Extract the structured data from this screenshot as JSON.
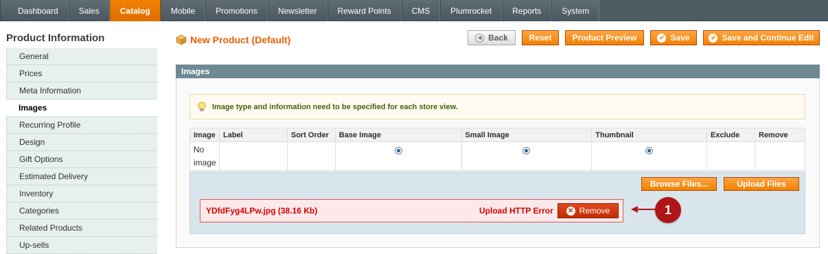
{
  "topnav": {
    "items": [
      "Dashboard",
      "Sales",
      "Catalog",
      "Mobile",
      "Promotions",
      "Newsletter",
      "Reward Points",
      "CMS",
      "Plumrocket",
      "Reports",
      "System"
    ],
    "active": "Catalog"
  },
  "sidebar": {
    "title": "Product Information",
    "items": [
      "General",
      "Prices",
      "Meta Information",
      "Images",
      "Recurring Profile",
      "Design",
      "Gift Options",
      "Estimated Delivery",
      "Inventory",
      "Categories",
      "Related Products",
      "Up-sells"
    ],
    "active": "Images"
  },
  "page": {
    "title": "New Product (Default)"
  },
  "buttons": {
    "back": "Back",
    "reset": "Reset",
    "preview": "Product Preview",
    "save": "Save",
    "save_continue": "Save and Continue Edit"
  },
  "images_section": {
    "heading": "Images",
    "notice": "Image type and information need to be specified for each store view.",
    "columns": [
      "Image",
      "Label",
      "Sort Order",
      "Base Image",
      "Small Image",
      "Thumbnail",
      "Exclude",
      "Remove"
    ],
    "row": {
      "image_line1": "No",
      "image_line2": "image"
    },
    "browse": "Browse Files...",
    "upload": "Upload Files",
    "file": {
      "name": "YDfdFyg4LPw.jpg (38.16 Kb)",
      "error": "Upload HTTP Error",
      "remove": "Remove"
    },
    "callout": "1"
  },
  "colors": {
    "accent": "#f18200",
    "nav_bg": "#4f5c64",
    "error": "#d40000",
    "callout": "#b01518"
  }
}
